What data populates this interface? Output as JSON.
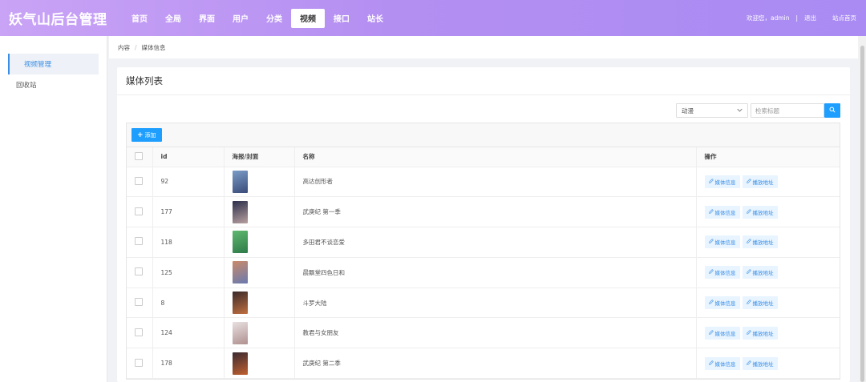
{
  "header": {
    "brand": "妖气山后台管理",
    "nav": [
      "首页",
      "全局",
      "界面",
      "用户",
      "分类",
      "视频",
      "接口",
      "站长"
    ],
    "nav_active_index": 5,
    "welcome": "欢迎您，admin",
    "sep": "|",
    "logout": "退出",
    "site_home": "站点首页",
    "gradient_colors": [
      "#c9a3f5",
      "#a98bf3"
    ]
  },
  "sidebar": {
    "items": [
      {
        "label": "视频管理",
        "active": true
      },
      {
        "label": "回收站",
        "active": false
      }
    ]
  },
  "breadcrumb": [
    "内容",
    "媒体信息"
  ],
  "panel": {
    "title": "媒体列表",
    "filter_select": "动漫",
    "search_placeholder": "检索标题",
    "add_label": "添加"
  },
  "table": {
    "headers": [
      "id",
      "海报/封面",
      "名称",
      "操作"
    ],
    "op_media": "媒体信息",
    "op_play": "播放地址",
    "rows": [
      {
        "id": "92",
        "name": "高达创形者",
        "poster": [
          "#7a9cc6",
          "#3b4c7a"
        ]
      },
      {
        "id": "177",
        "name": "武庚纪 第一季",
        "poster": [
          "#2c2f4a",
          "#b8a0a0"
        ]
      },
      {
        "id": "118",
        "name": "多田君不谈恋爱",
        "poster": [
          "#5fb86e",
          "#2e7a4a"
        ]
      },
      {
        "id": "125",
        "name": "晨飘堂四色日和",
        "poster": [
          "#c98b6a",
          "#6a7ab0"
        ]
      },
      {
        "id": "8",
        "name": "斗罗大陆",
        "poster": [
          "#3a2a2a",
          "#c07040"
        ]
      },
      {
        "id": "124",
        "name": "教君与女朋友",
        "poster": [
          "#e8e0e0",
          "#b09090"
        ]
      },
      {
        "id": "178",
        "name": "武庚纪 第二季",
        "poster": [
          "#3a2a30",
          "#c06030"
        ]
      }
    ]
  },
  "colors": {
    "accent": "#1e9fff",
    "active_link": "#3a8ee6"
  }
}
